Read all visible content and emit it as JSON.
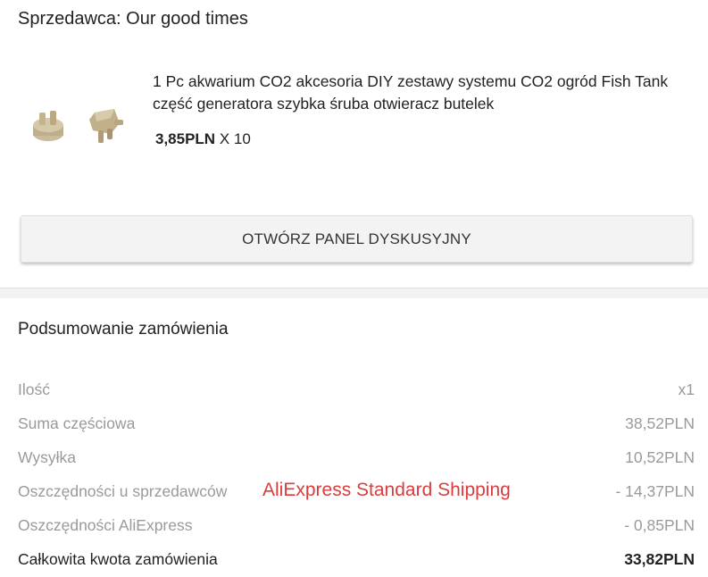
{
  "seller": {
    "label": "Sprzedawca: Our good times"
  },
  "product": {
    "title": "1 Pc akwarium CO2 akcesoria DIY zestawy systemu CO2 ogród Fish Tank część generatora szybka śruba otwieracz butelek",
    "price": "3,85PLN",
    "quantity": " X 10",
    "image_icon": "co2-fitting-parts"
  },
  "chat_button": {
    "label": "OTWÓRZ PANEL DYSKUSYJNY"
  },
  "summary": {
    "title": "Podsumowanie zamówienia",
    "rows": [
      {
        "label": "Ilość",
        "value": "x1"
      },
      {
        "label": "Suma częściowa",
        "value": "38,52PLN"
      },
      {
        "label": "Wysyłka",
        "value": "10,52PLN"
      },
      {
        "label": "Oszczędności u sprzedawców",
        "value": "- 14,37PLN"
      },
      {
        "label": "Oszczędności AliExpress",
        "value": "- 0,85PLN"
      },
      {
        "label": "Całkowita kwota zamówienia",
        "value": "33,82PLN"
      }
    ]
  },
  "overlay": {
    "shipping_method": "AliExpress Standard Shipping"
  },
  "colors": {
    "overlay_text": "#d93d3d",
    "muted_text": "#9a9a9a",
    "button_bg": "#f3f3f3"
  }
}
